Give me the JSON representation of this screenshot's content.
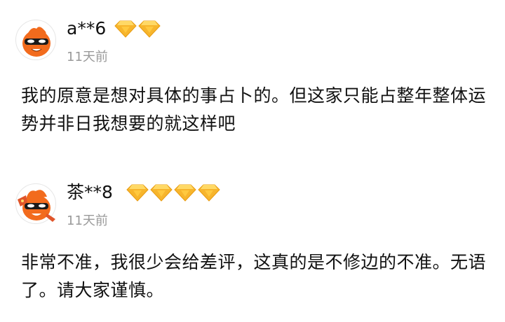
{
  "reviews": [
    {
      "username": "a**6",
      "time": "11天前",
      "diamond_count": 2,
      "content": "我的原意是想对具体的事占卜的。但这家只能占整年整体运势并非日我想要的就这样吧"
    },
    {
      "username": "茶**8",
      "time": "11天前",
      "diamond_count": 4,
      "content": "非常不准，我很少会给差评，这真的是不修边的不准。无语了。请大家谨慎。"
    }
  ],
  "colors": {
    "diamond_gold": "#f7b52c",
    "diamond_light": "#ffd966",
    "avatar_orange": "#f26b1d",
    "time_gray": "#9a9a9a",
    "text": "#111111"
  },
  "icons": [
    "mascot-avatar-icon",
    "diamond-level-icon"
  ]
}
